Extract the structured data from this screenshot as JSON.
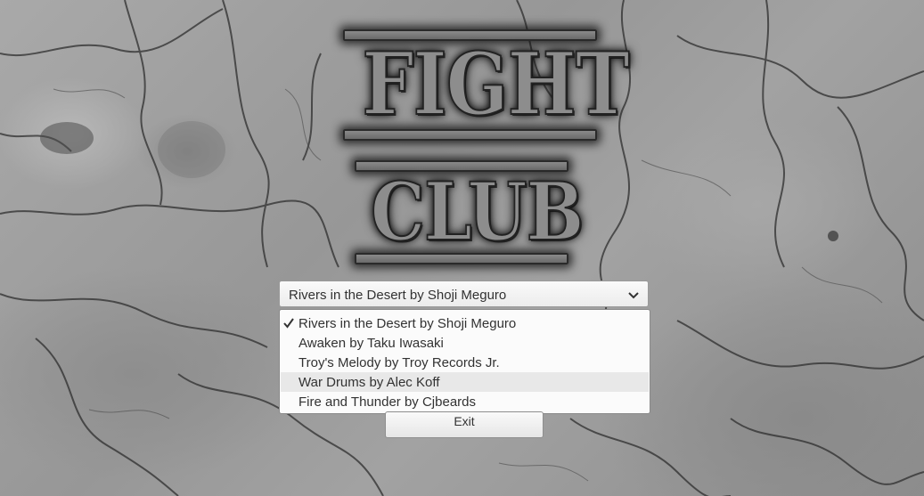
{
  "logo": {
    "line1": "FIGHT",
    "line2": "CLUB"
  },
  "music_select": {
    "selected": "Rivers in the Desert by Shoji Meguro",
    "options": [
      {
        "label": "Rivers in the Desert by Shoji Meguro",
        "checked": true,
        "hovered": false
      },
      {
        "label": "Awaken by Taku Iwasaki",
        "checked": false,
        "hovered": false
      },
      {
        "label": "Troy's Melody by Troy Records Jr.",
        "checked": false,
        "hovered": false
      },
      {
        "label": "War Drums by Alec Koff",
        "checked": false,
        "hovered": true
      },
      {
        "label": "Fire and Thunder by Cjbeards",
        "checked": false,
        "hovered": false
      }
    ]
  },
  "exit_button": {
    "label": "Exit"
  },
  "icons": {
    "dropdown": "chevron-down-icon",
    "selected": "checkmark-icon"
  },
  "colors": {
    "ui_text": "#323232",
    "hover": "#e8e8e8"
  }
}
